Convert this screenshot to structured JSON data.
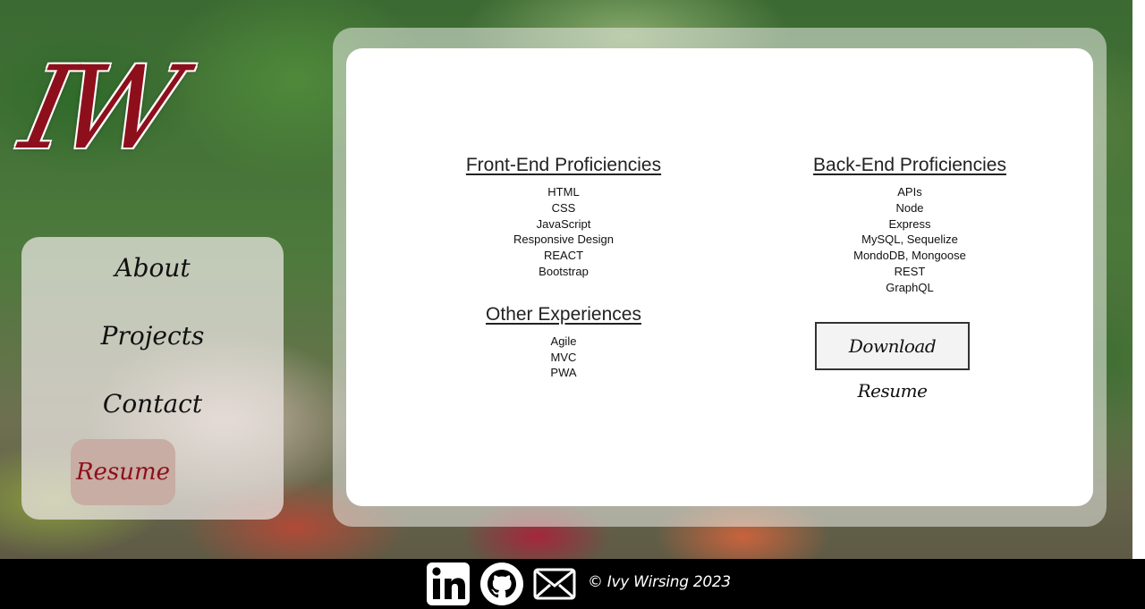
{
  "brand": {
    "logo_text": "IW"
  },
  "nav": {
    "items": [
      {
        "label": "About"
      },
      {
        "label": "Projects"
      },
      {
        "label": "Contact"
      },
      {
        "label": "Resume",
        "active": true
      }
    ]
  },
  "resume": {
    "front_end": {
      "title": "Front-End Proficiencies",
      "items": [
        "HTML",
        "CSS",
        "JavaScript",
        "Responsive Design",
        "REACT",
        "Bootstrap"
      ]
    },
    "other": {
      "title": "Other Experiences",
      "items": [
        "Agile",
        "MVC",
        "PWA"
      ]
    },
    "back_end": {
      "title": "Back-End Proficiencies",
      "items": [
        "APIs",
        "Node",
        "Express",
        "MySQL, Sequelize",
        "MondoDB, Mongoose",
        "REST",
        "GraphQL"
      ]
    },
    "download_label": "Download Resume"
  },
  "footer": {
    "icons": [
      "linkedin-icon",
      "github-icon",
      "mail-icon"
    ],
    "copyright": "© Ivy Wirsing 2023"
  },
  "colors": {
    "accent": "#8e0f1c",
    "active_nav_bg": "#c7ada3",
    "footer_bg": "#000000"
  }
}
